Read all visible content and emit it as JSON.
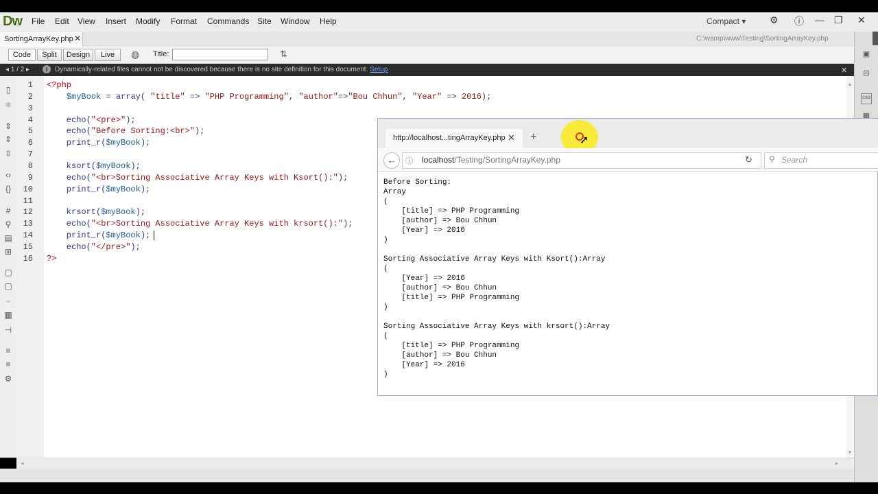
{
  "app": {
    "logo": "Dw",
    "compact_label": "Compact ▾"
  },
  "menu": [
    "File",
    "Edit",
    "View",
    "Insert",
    "Modify",
    "Format",
    "Commands",
    "Site",
    "Window",
    "Help"
  ],
  "document": {
    "tab_label": "SortingArrayKey.php",
    "path": "C:\\wamp\\www\\Testing\\SortingArrayKey.php"
  },
  "toolbar": {
    "code": "Code",
    "split": "Split",
    "design": "Design",
    "live": "Live",
    "title_label": "Title:",
    "title_value": ""
  },
  "infobar": {
    "nav": "1 / 2",
    "message": "Dynamically-related files cannot not be discovered because there is no site definition for this document.",
    "link": "Setup"
  },
  "code_lines": [
    {
      "n": "1",
      "parts": [
        {
          "c": "kw",
          "t": "<?php"
        }
      ]
    },
    {
      "n": "2",
      "parts": [
        {
          "c": "",
          "t": "    "
        },
        {
          "c": "var",
          "t": "$myBook"
        },
        {
          "c": "",
          "t": " = array( "
        },
        {
          "c": "str",
          "t": "\"title\""
        },
        {
          "c": "",
          "t": " => "
        },
        {
          "c": "str",
          "t": "\"PHP Programming\""
        },
        {
          "c": "",
          "t": ", "
        },
        {
          "c": "str",
          "t": "\"author\""
        },
        {
          "c": "",
          "t": "=>"
        },
        {
          "c": "str",
          "t": "\"Bou Chhun\""
        },
        {
          "c": "",
          "t": ", "
        },
        {
          "c": "str",
          "t": "\"Year\""
        },
        {
          "c": "",
          "t": " => "
        },
        {
          "c": "str",
          "t": "2016"
        },
        {
          "c": "",
          "t": ");"
        }
      ]
    },
    {
      "n": "3",
      "parts": []
    },
    {
      "n": "4",
      "parts": [
        {
          "c": "",
          "t": "    echo("
        },
        {
          "c": "str",
          "t": "\"<pre>\""
        },
        {
          "c": "",
          "t": ");"
        }
      ]
    },
    {
      "n": "5",
      "parts": [
        {
          "c": "",
          "t": "    echo("
        },
        {
          "c": "str",
          "t": "\"Before Sorting:<br>\""
        },
        {
          "c": "",
          "t": ");"
        }
      ]
    },
    {
      "n": "6",
      "parts": [
        {
          "c": "",
          "t": "    print_r("
        },
        {
          "c": "var",
          "t": "$myBook"
        },
        {
          "c": "",
          "t": ");"
        }
      ]
    },
    {
      "n": "7",
      "parts": []
    },
    {
      "n": "8",
      "parts": [
        {
          "c": "",
          "t": "    ksort("
        },
        {
          "c": "var",
          "t": "$myBook"
        },
        {
          "c": "",
          "t": ");"
        }
      ]
    },
    {
      "n": "9",
      "parts": [
        {
          "c": "",
          "t": "    echo("
        },
        {
          "c": "str",
          "t": "\"<br>Sorting Associative Array Keys with Ksort():\""
        },
        {
          "c": "",
          "t": ");"
        }
      ]
    },
    {
      "n": "10",
      "parts": [
        {
          "c": "",
          "t": "    print_r("
        },
        {
          "c": "var",
          "t": "$myBook"
        },
        {
          "c": "",
          "t": ");"
        }
      ]
    },
    {
      "n": "11",
      "parts": []
    },
    {
      "n": "12",
      "parts": [
        {
          "c": "",
          "t": "    krsort("
        },
        {
          "c": "var",
          "t": "$myBook"
        },
        {
          "c": "",
          "t": ");"
        }
      ]
    },
    {
      "n": "13",
      "parts": [
        {
          "c": "",
          "t": "    echo("
        },
        {
          "c": "str",
          "t": "\"<br>Sorting Associative Array Keys with krsort():\""
        },
        {
          "c": "",
          "t": ");"
        }
      ]
    },
    {
      "n": "14",
      "parts": [
        {
          "c": "",
          "t": "    print_r("
        },
        {
          "c": "var",
          "t": "$myBook"
        },
        {
          "c": "",
          "t": ");"
        }
      ]
    },
    {
      "n": "15",
      "parts": [
        {
          "c": "",
          "t": "    echo("
        },
        {
          "c": "str",
          "t": "\"</pre>\""
        },
        {
          "c": "",
          "t": ");"
        }
      ]
    },
    {
      "n": "16",
      "parts": [
        {
          "c": "kw",
          "t": "?>"
        }
      ]
    }
  ],
  "browser": {
    "tab_label": "http://localhost...tingArrayKey.php",
    "url_host": "localhost",
    "url_path": "/Testing/SortingArrayKey.php",
    "search_placeholder": "Search",
    "output": "Before Sorting:\nArray\n(\n    [title] => PHP Programming\n    [author] => Bou Chhun\n    [Year] => 2016\n)\n\nSorting Associative Array Keys with Ksort():Array\n(\n    [Year] => 2016\n    [author] => Bou Chhun\n    [title] => PHP Programming\n)\n\nSorting Associative Array Keys with krsort():Array\n(\n    [title] => PHP Programming\n    [author] => Bou Chhun\n    [Year] => 2016\n)"
  },
  "icons": {
    "close": "close-icon",
    "new_tab": "plus-icon",
    "back": "back-arrow-icon",
    "reload": "reload-icon",
    "search": "search-icon"
  }
}
